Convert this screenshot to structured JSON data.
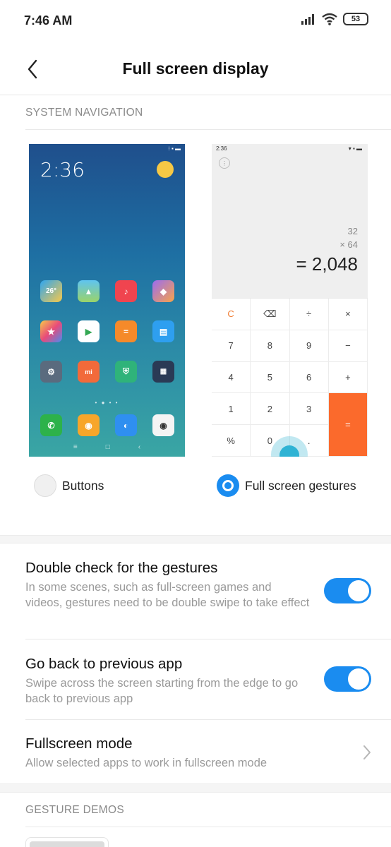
{
  "status_bar": {
    "time": "7:46 AM",
    "battery": "53"
  },
  "header": {
    "title": "Full screen display"
  },
  "system_navigation": {
    "section_label": "SYSTEM NAVIGATION",
    "buttons_preview": {
      "status_time": "",
      "clock": "2:36",
      "app_icon_label": "26°"
    },
    "gestures_preview": {
      "status_time": "2:36",
      "operand1": "32",
      "operand2": "× 64",
      "result": "= 2,048",
      "keys": [
        "C",
        "⌫",
        "÷",
        "×",
        "7",
        "8",
        "9",
        "−",
        "4",
        "5",
        "6",
        "+",
        "1",
        "2",
        "3",
        "%",
        "0",
        "."
      ],
      "equals": "="
    },
    "options": [
      {
        "label": "Buttons",
        "selected": false
      },
      {
        "label": "Full screen gestures",
        "selected": true
      }
    ]
  },
  "settings": [
    {
      "title": "Double check for the gestures",
      "description": "In some scenes, such as full-screen games and videos, gestures need to be double swipe to take effect",
      "control": "toggle",
      "on": true
    },
    {
      "title": "Go back to previous app",
      "description": "Swipe across the screen starting from the edge to go back to previous app",
      "control": "toggle",
      "on": true
    },
    {
      "title": "Fullscreen mode",
      "description": "Allow selected apps to work in fullscreen mode",
      "control": "chevron"
    }
  ],
  "gesture_demos": {
    "section_label": "GESTURE DEMOS"
  },
  "colors": {
    "accent": "#1a8cf0",
    "orange": "#fb6a2c",
    "muted_text": "#9a9a9a"
  }
}
